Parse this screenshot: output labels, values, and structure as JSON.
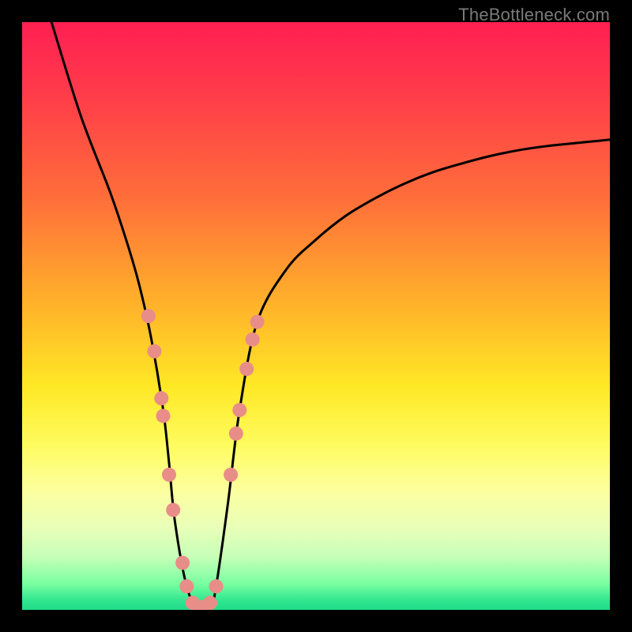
{
  "watermark": {
    "text": "TheBottleneck.com"
  },
  "chart_data": {
    "type": "line",
    "title": "",
    "xlabel": "",
    "ylabel": "",
    "xlim": [
      0,
      100
    ],
    "ylim": [
      0,
      100
    ],
    "background_gradient_stops": [
      {
        "pos": 0.0,
        "color": "#ff1f52"
      },
      {
        "pos": 0.12,
        "color": "#ff3b4a"
      },
      {
        "pos": 0.3,
        "color": "#ff6e3a"
      },
      {
        "pos": 0.48,
        "color": "#ffb22a"
      },
      {
        "pos": 0.62,
        "color": "#ffe825"
      },
      {
        "pos": 0.72,
        "color": "#fffc60"
      },
      {
        "pos": 0.8,
        "color": "#fbffa0"
      },
      {
        "pos": 0.86,
        "color": "#e9ffb8"
      },
      {
        "pos": 0.91,
        "color": "#c6ffb8"
      },
      {
        "pos": 0.955,
        "color": "#7affa0"
      },
      {
        "pos": 0.985,
        "color": "#2fe58f"
      },
      {
        "pos": 1.0,
        "color": "#1fdb87"
      }
    ],
    "series": [
      {
        "name": "bottleneck-curve",
        "color": "#000000",
        "x": [
          5,
          10,
          15,
          18,
          20,
          22,
          24,
          25,
          26,
          28,
          30,
          32,
          33,
          35,
          37,
          40,
          45,
          50,
          55,
          60,
          65,
          70,
          75,
          80,
          85,
          90,
          95,
          100
        ],
        "y": [
          100,
          84,
          71,
          62,
          55,
          46,
          34,
          25,
          15,
          4,
          0,
          0,
          4,
          18,
          34,
          49,
          58,
          63,
          67,
          70,
          72.5,
          74.5,
          76,
          77.3,
          78.3,
          79,
          79.5,
          80
        ]
      }
    ],
    "markers": {
      "name": "highlight-points",
      "color": "#e98d88",
      "radius": 9,
      "points": [
        {
          "x": 21.5,
          "y": 50
        },
        {
          "x": 22.5,
          "y": 44
        },
        {
          "x": 23.7,
          "y": 36
        },
        {
          "x": 24.0,
          "y": 33
        },
        {
          "x": 25.0,
          "y": 23
        },
        {
          "x": 25.7,
          "y": 17
        },
        {
          "x": 27.3,
          "y": 8
        },
        {
          "x": 28.0,
          "y": 4
        },
        {
          "x": 29.0,
          "y": 1.2
        },
        {
          "x": 30.0,
          "y": 0.5
        },
        {
          "x": 31.0,
          "y": 0.5
        },
        {
          "x": 32.0,
          "y": 1.2
        },
        {
          "x": 33.0,
          "y": 4
        },
        {
          "x": 35.5,
          "y": 23
        },
        {
          "x": 36.4,
          "y": 30
        },
        {
          "x": 37.0,
          "y": 34
        },
        {
          "x": 38.2,
          "y": 41
        },
        {
          "x": 39.2,
          "y": 46
        },
        {
          "x": 40.0,
          "y": 49
        }
      ]
    }
  }
}
